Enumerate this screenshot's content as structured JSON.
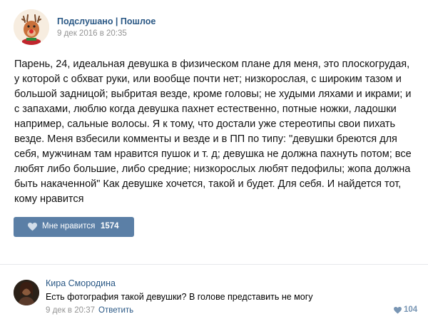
{
  "post": {
    "author": "Подслушано | Пошлое",
    "date": "9 дек 2016 в 20:35",
    "avatar_icon": "reindeer-avatar-icon",
    "text": "Парень, 24, идеальная девушка в физическом плане для меня, это плоскогрудая, у которой с обхват руки, или вообще почти нет; низкорослая, с широким тазом и большой задницой; выбритая везде, кроме головы; не худыми ляхами и икрами; и с запахами, люблю когда девушка пахнет естественно, потные ножки, ладошки например, сальные волосы. Я к тому, что достали уже стереотипы свои пихать везде. Меня взбесили комменты и везде и в ПП по типу: \"девушки бреются для себя, мужчинам там нравится пушок и т. д; девушка не должна пахнуть потом; все любят либо большие, либо средние; низкорослых любят педофилы; жопа должна быть накаченной\" Как девушке хочется, такой и будет. Для себя. И найдется тот, кому нравится",
    "like_label": "Мне нравится",
    "like_count": "1574",
    "like_icon": "heart-icon"
  },
  "comment": {
    "author": "Кира Смородина",
    "avatar_icon": "user-photo-avatar",
    "text": "Есть фотография такой девушки? В голове представить не могу",
    "date": "9 дек в 20:37",
    "reply_label": "Ответить",
    "like_count": "104",
    "like_icon": "heart-icon"
  },
  "colors": {
    "link": "#2a5885",
    "like_button": "#5b7fa6",
    "muted": "#939393",
    "divider": "#e7e8ec"
  }
}
